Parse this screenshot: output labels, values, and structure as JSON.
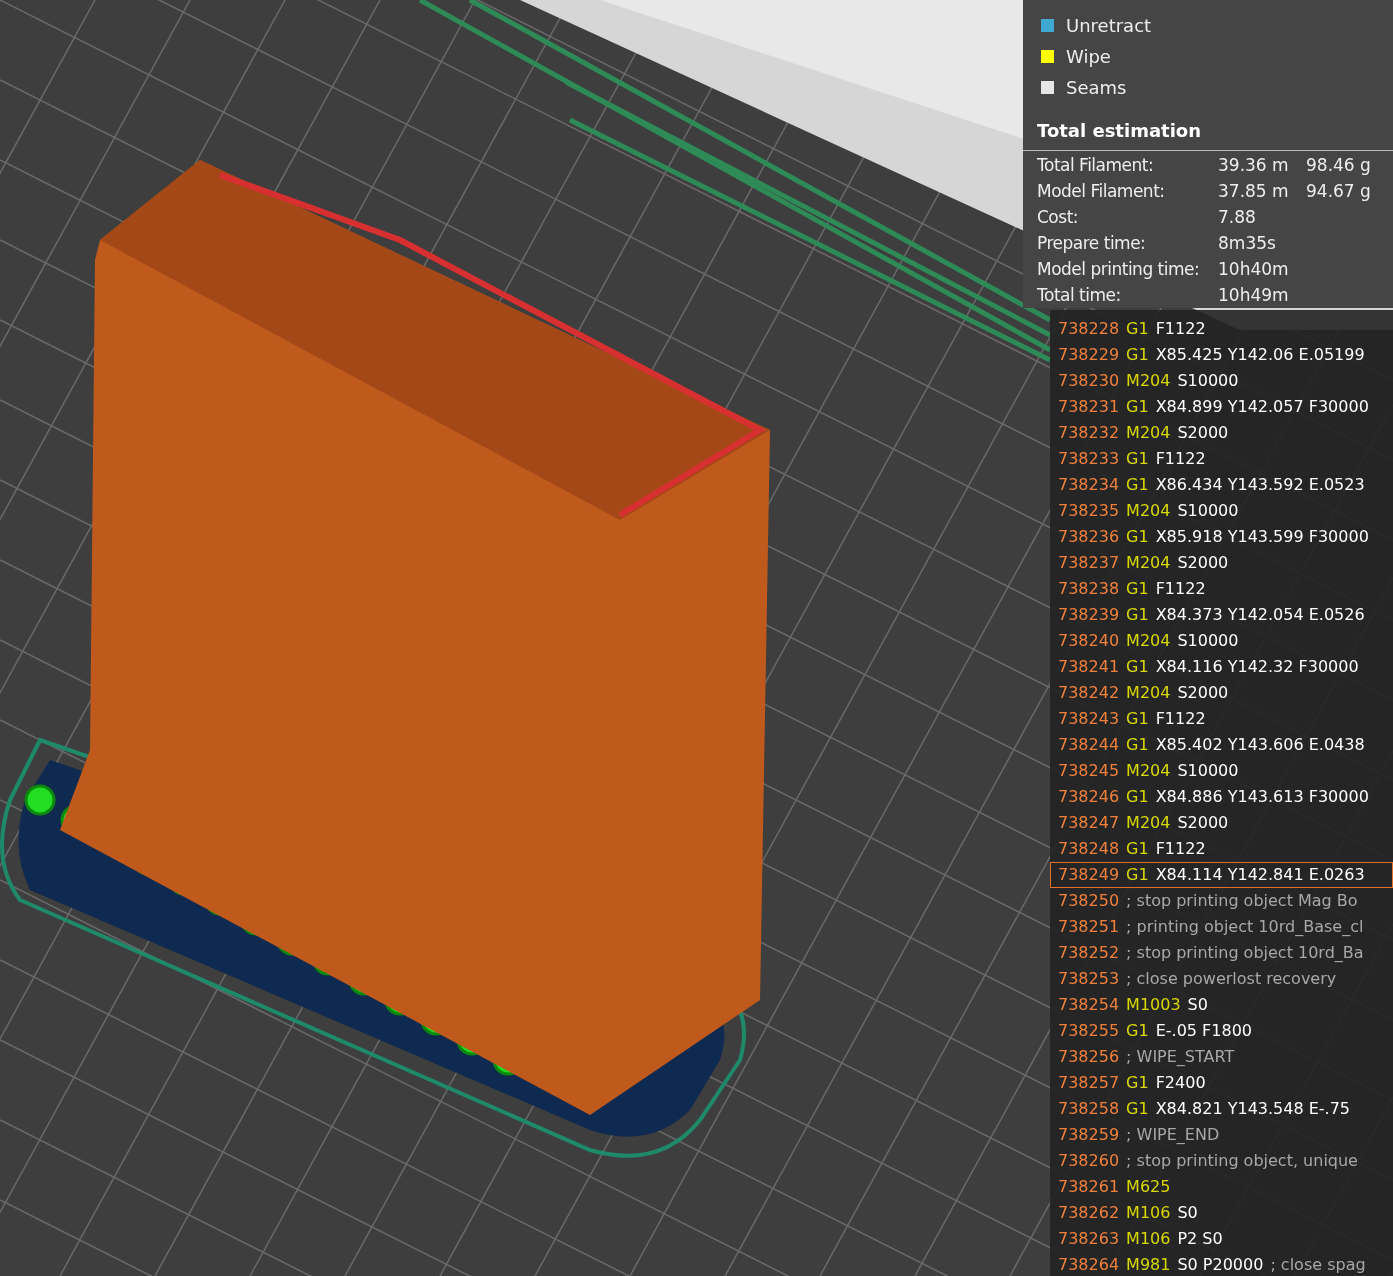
{
  "legend": [
    {
      "label": "Unretract",
      "color": "#3fa9d4"
    },
    {
      "label": "Wipe",
      "color": "#ffff00"
    },
    {
      "label": "Seams",
      "color": "#e6e6e6"
    }
  ],
  "estimation": {
    "title": "Total estimation",
    "rows": [
      {
        "label": "Total Filament:",
        "values": [
          "39.36 m",
          "98.46 g"
        ]
      },
      {
        "label": "Model Filament:",
        "values": [
          "37.85 m",
          "94.67 g"
        ]
      },
      {
        "label": "Cost:",
        "values": [
          "7.88"
        ]
      },
      {
        "label": "Prepare time:",
        "values": [
          "8m35s"
        ]
      },
      {
        "label": "Model printing time:",
        "values": [
          "10h40m"
        ]
      },
      {
        "label": "Total time:",
        "values": [
          "10h49m"
        ]
      }
    ]
  },
  "gcode": {
    "lines": [
      {
        "number": "738228",
        "code": "G1",
        "params": "F1122",
        "selected": false
      },
      {
        "number": "738229",
        "code": "G1",
        "params": "X85.425 Y142.06 E.05199",
        "selected": false
      },
      {
        "number": "738230",
        "code": "M204",
        "params": "S10000",
        "selected": false
      },
      {
        "number": "738231",
        "code": "G1",
        "params": "X84.899 Y142.057 F30000",
        "selected": false
      },
      {
        "number": "738232",
        "code": "M204",
        "params": "S2000",
        "selected": false
      },
      {
        "number": "738233",
        "code": "G1",
        "params": "F1122",
        "selected": false
      },
      {
        "number": "738234",
        "code": "G1",
        "params": "X86.434 Y143.592 E.0523",
        "selected": false
      },
      {
        "number": "738235",
        "code": "M204",
        "params": "S10000",
        "selected": false
      },
      {
        "number": "738236",
        "code": "G1",
        "params": "X85.918 Y143.599 F30000",
        "selected": false
      },
      {
        "number": "738237",
        "code": "M204",
        "params": "S2000",
        "selected": false
      },
      {
        "number": "738238",
        "code": "G1",
        "params": "F1122",
        "selected": false
      },
      {
        "number": "738239",
        "code": "G1",
        "params": "X84.373 Y142.054 E.0526",
        "selected": false
      },
      {
        "number": "738240",
        "code": "M204",
        "params": "S10000",
        "selected": false
      },
      {
        "number": "738241",
        "code": "G1",
        "params": "X84.116 Y142.32 F30000",
        "selected": false
      },
      {
        "number": "738242",
        "code": "M204",
        "params": "S2000",
        "selected": false
      },
      {
        "number": "738243",
        "code": "G1",
        "params": "F1122",
        "selected": false
      },
      {
        "number": "738244",
        "code": "G1",
        "params": "X85.402 Y143.606 E.0438",
        "selected": false
      },
      {
        "number": "738245",
        "code": "M204",
        "params": "S10000",
        "selected": false
      },
      {
        "number": "738246",
        "code": "G1",
        "params": "X84.886 Y143.613 F30000",
        "selected": false
      },
      {
        "number": "738247",
        "code": "M204",
        "params": "S2000",
        "selected": false
      },
      {
        "number": "738248",
        "code": "G1",
        "params": "F1122",
        "selected": false
      },
      {
        "number": "738249",
        "code": "G1",
        "params": "X84.114 Y142.841 E.0263",
        "selected": true
      },
      {
        "number": "738250",
        "comment": "; stop printing object Mag Bo",
        "selected": false
      },
      {
        "number": "738251",
        "comment": "; printing object 10rd_Base_cl",
        "selected": false
      },
      {
        "number": "738252",
        "comment": "; stop printing object 10rd_Ba",
        "selected": false
      },
      {
        "number": "738253",
        "comment": "; close powerlost recovery",
        "selected": false
      },
      {
        "number": "738254",
        "code": "M1003",
        "params": "S0",
        "selected": false
      },
      {
        "number": "738255",
        "code": "G1",
        "params": "E-.05 F1800",
        "selected": false
      },
      {
        "number": "738256",
        "comment": "; WIPE_START",
        "selected": false
      },
      {
        "number": "738257",
        "code": "G1",
        "params": "F2400",
        "selected": false
      },
      {
        "number": "738258",
        "code": "G1",
        "params": "X84.821 Y143.548 E-.75",
        "selected": false
      },
      {
        "number": "738259",
        "comment": "; WIPE_END",
        "selected": false
      },
      {
        "number": "738260",
        "comment": "; stop printing object, unique",
        "selected": false
      },
      {
        "number": "738261",
        "code": "M625",
        "selected": false
      },
      {
        "number": "738262",
        "code": "M106",
        "params": "S0",
        "selected": false
      },
      {
        "number": "738263",
        "code": "M106",
        "params": "P2 S0",
        "selected": false
      },
      {
        "number": "738264",
        "code": "M981",
        "params": "S0 P20000",
        "comment": "; close spag",
        "selected": false
      }
    ]
  }
}
